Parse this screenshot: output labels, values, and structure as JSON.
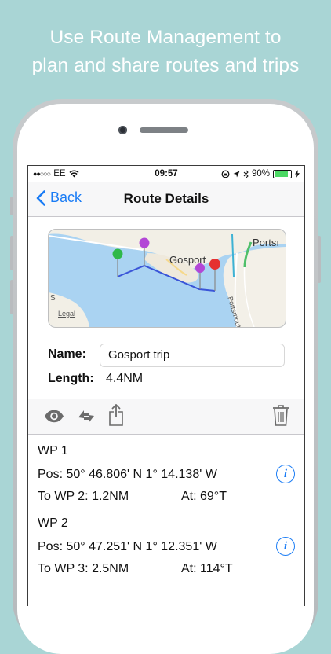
{
  "caption": {
    "line1": "Use Route Management to",
    "line2": "plan and share routes and trips"
  },
  "status_bar": {
    "signal": "●●○○○",
    "carrier": "EE",
    "time": "09:57",
    "battery": "90%"
  },
  "nav": {
    "back_label": "Back",
    "title": "Route Details"
  },
  "map": {
    "labels": {
      "town1": "Gosport",
      "town2": "Portsı",
      "road": "Portsmouth - B",
      "legal": "Legal",
      "edge": "S"
    },
    "route_color": "#3a55d8",
    "pins": [
      "green",
      "purple",
      "purple",
      "red"
    ]
  },
  "route": {
    "name_label": "Name:",
    "name_value": "Gosport trip",
    "length_label": "Length:",
    "length_value": "4.4NM"
  },
  "toolbar": {
    "icons": [
      "eye-icon",
      "swap-icon",
      "share-icon",
      "trash-icon"
    ]
  },
  "waypoints": [
    {
      "name": "WP 1",
      "pos": "Pos: 50° 46.806' N 1° 14.138' W",
      "to": "To WP 2: 1.2NM",
      "at": "At: 69°T"
    },
    {
      "name": "WP 2",
      "pos": "Pos: 50° 47.251' N 1° 12.351' W",
      "to": "To WP 3: 2.5NM",
      "at": "At: 114°T"
    }
  ],
  "colors": {
    "accent": "#1a7cf5",
    "background": "#a9d5d5"
  }
}
